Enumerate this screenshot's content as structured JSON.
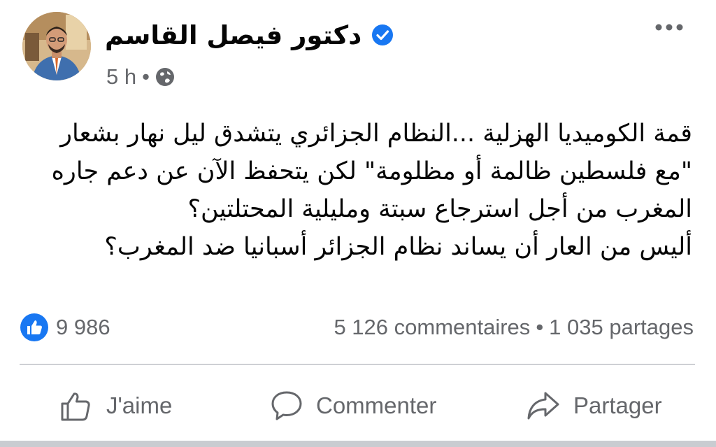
{
  "author": {
    "name": "دكتور فيصل القاسم",
    "verified": true,
    "time": "5 h",
    "separator": "•",
    "audience_icon": "globe-icon"
  },
  "post": {
    "lines": [
      "قمة الكوميديا الهزلية ...النظام الجزائري يتشدق ليل نهار بشعار",
      "\"مع فلسطين ظالمة أو مظلومة\" لكن يتحفظ الآن عن دعم جاره",
      "المغرب  من أجل استرجاع سبتة ومليلية المحتلتين؟",
      "أليس من العار أن يساند  نظام الجزائر أسبانيا ضد المغرب؟"
    ]
  },
  "stats": {
    "reactions": "9 986",
    "comments": "5 126 commentaires",
    "dot": "•",
    "shares": "1 035 partages"
  },
  "actions": {
    "like": "J'aime",
    "comment": "Commenter",
    "share": "Partager"
  },
  "colors": {
    "facebook_blue": "#1877f2",
    "secondary_text": "#65676b",
    "divider": "#ced0d4"
  }
}
